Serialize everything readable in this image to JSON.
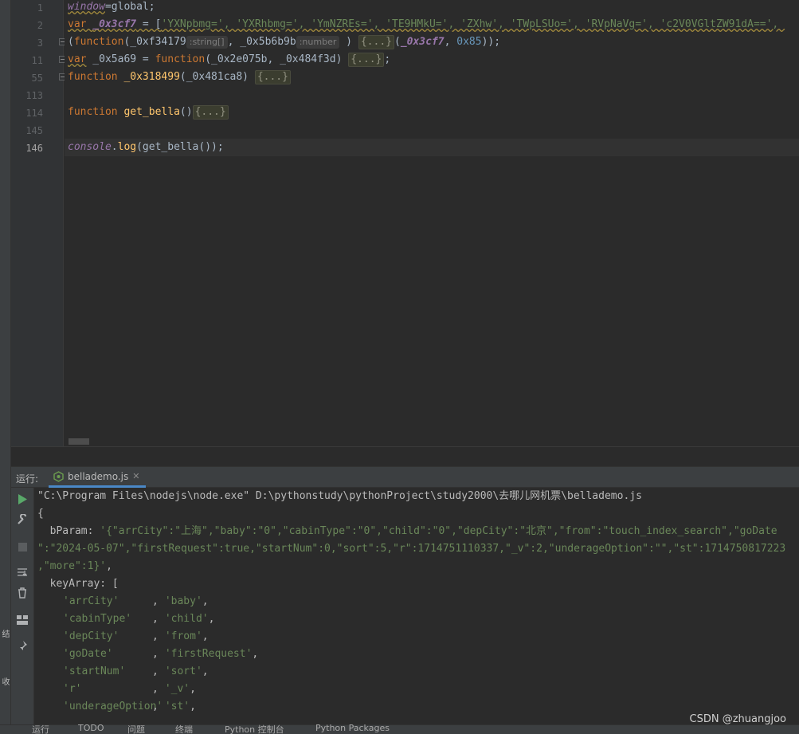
{
  "editor": {
    "line_numbers": [
      "1",
      "2",
      "3",
      "11",
      "55",
      "113",
      "114",
      "145",
      "146"
    ],
    "line1": {
      "gl": "window",
      "rest": "=global;"
    },
    "line2": {
      "kw": "var ",
      "name": "_0x3cf7",
      "eq": " = [",
      "items": "'YXNpbmg=', 'YXRhbmg=', 'YmNZREs=', 'TE9HMkU=', 'ZXhw', 'TWpLSUo=', 'RVpNaVg=', 'c2V0VGltZW91dA==', "
    },
    "line3": {
      "open": "(",
      "kw": "function",
      "paren": "(",
      "p1": "_0xf34179",
      "h1": ":string[]",
      "comma": ", ",
      "p2": "_0x5b6b9b",
      "h2": ":number",
      "close": " ) ",
      "fold": "{...}",
      "call_open": "(",
      "arg1": "_0x3cf7",
      "comma2": ", ",
      "arg2": "0x85",
      "call_close": "));"
    },
    "line11": {
      "kw": "var",
      "name": " _0x5a69",
      "eq": " = ",
      "kw2": "function",
      "params": "(_0x2e075b, _0x484f3d) ",
      "fold": "{...}",
      "end": ";"
    },
    "line55": {
      "kw": "function",
      "name": " _0x318499",
      "params": "(_0x481ca8) ",
      "fold": "{...}"
    },
    "line114": {
      "kw": "function",
      "name": " get_bella",
      "params": "()",
      "fold": "{...}"
    },
    "line146": {
      "obj": "console",
      "dot": ".",
      "call": "log",
      "args": "(get_bella());"
    }
  },
  "run_panel": {
    "title": "运行:",
    "tab_label": "bellademo.js",
    "console": {
      "cmd": "\"C:\\Program Files\\nodejs\\node.exe\" D:\\pythonstudy\\pythonProject\\study2000\\去哪儿网机票\\bellademo.js",
      "brace": "{",
      "bparam_key": "  bParam: ",
      "bparam_v1": "'{\"arrCity\":\"上海\",\"baby\":\"0\",\"cabinType\":\"0\",\"child\":\"0\",\"depCity\":\"北京\",\"from\":\"touch_index_search\",\"goDate",
      "bparam_v2": "\":\"2024-05-07\",\"firstRequest\":true,\"startNum\":0,\"sort\":5,\"r\":1714751110337,\"_v\":2,\"underageOption\":\"\",\"st\":1714750817223",
      "bparam_v3": ",\"more\":1}'",
      "bparam_end": ",",
      "keyarray_key": "  keyArray: [",
      "rows": [
        [
          "'arrCity'",
          "'baby'"
        ],
        [
          "'cabinType'",
          "'child'"
        ],
        [
          "'depCity'",
          "'from'"
        ],
        [
          "'goDate'",
          "'firstRequest'"
        ],
        [
          "'startNum'",
          "'sort'"
        ],
        [
          "'r'",
          "'_v'"
        ],
        [
          "'underageOption'",
          "'st'"
        ]
      ]
    }
  },
  "side_labels": {
    "structure": "结构",
    "favorites": "收藏夹"
  },
  "status_bar": [
    "运行",
    "TODO",
    "问题",
    "终端",
    "Python 控制台",
    "Python Packages"
  ],
  "watermark": "CSDN @zhuangjoo",
  "icons": {
    "run": "play-icon",
    "wrench": "wrench-icon",
    "stop": "stop-icon",
    "scroll": "scroll-end-icon",
    "trash": "trash-icon",
    "layout": "layout-icon",
    "pin": "pin-icon",
    "node": "nodejs-icon",
    "close": "close-icon"
  }
}
